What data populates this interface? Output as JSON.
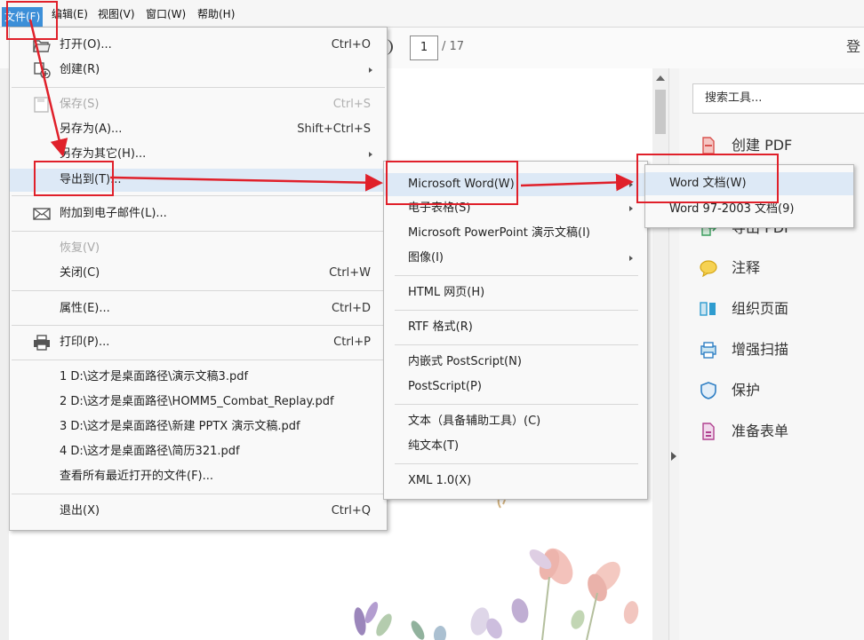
{
  "menubar": {
    "file": "文件(F)",
    "edit": "编辑(E)",
    "view": "视图(V)",
    "window": "窗口(W)",
    "help": "帮助(H)"
  },
  "toolbar": {
    "page_current": "1",
    "page_total": "/ 17",
    "login": "登"
  },
  "right_panel": {
    "search_placeholder": "搜索工具...",
    "tools": [
      {
        "label": "创建 PDF",
        "icon": "create-pdf-icon"
      },
      {
        "label": "导出 PDF",
        "icon": "export-pdf-icon"
      },
      {
        "label": "注释",
        "icon": "comment-icon"
      },
      {
        "label": "组织页面",
        "icon": "organize-pages-icon"
      },
      {
        "label": "增强扫描",
        "icon": "enhance-scan-icon"
      },
      {
        "label": "保护",
        "icon": "shield-icon"
      },
      {
        "label": "准备表单",
        "icon": "form-icon"
      }
    ]
  },
  "file_menu": {
    "open": {
      "label": "打开(O)...",
      "shortcut": "Ctrl+O"
    },
    "create": {
      "label": "创建(R)"
    },
    "save": {
      "label": "保存(S)",
      "shortcut": "Ctrl+S"
    },
    "save_as": {
      "label": "另存为(A)...",
      "shortcut": "Shift+Ctrl+S"
    },
    "save_as_other": {
      "label": "另存为其它(H)..."
    },
    "export_to": {
      "label": "导出到(T)..."
    },
    "attach_email": {
      "label": "附加到电子邮件(L)..."
    },
    "revert": {
      "label": "恢复(V)"
    },
    "close": {
      "label": "关闭(C)",
      "shortcut": "Ctrl+W"
    },
    "properties": {
      "label": "属性(E)...",
      "shortcut": "Ctrl+D"
    },
    "print": {
      "label": "打印(P)...",
      "shortcut": "Ctrl+P"
    },
    "recent": [
      "1 D:\\这才是桌面路径\\演示文稿3.pdf",
      "2 D:\\这才是桌面路径\\HOMM5_Combat_Replay.pdf",
      "3 D:\\这才是桌面路径\\新建 PPTX 演示文稿.pdf",
      "4 D:\\这才是桌面路径\\简历321.pdf"
    ],
    "view_all_recent": "查看所有最近打开的文件(F)...",
    "exit": {
      "label": "退出(X)",
      "shortcut": "Ctrl+Q"
    }
  },
  "export_menu": {
    "items": {
      "word": "Microsoft Word(W)",
      "spreadsheet": "电子表格(S)",
      "powerpoint": "Microsoft PowerPoint 演示文稿(I)",
      "image": "图像(I)",
      "html": "HTML 网页(H)",
      "rtf": "RTF 格式(R)",
      "embedded_postscript": "内嵌式 PostScript(N)",
      "postscript": "PostScript(P)",
      "text_accessible": "文本（具备辅助工具）(C)",
      "plain_text": "纯文本(T)",
      "xml": "XML 1.0(X)"
    }
  },
  "word_menu": {
    "word_doc": "Word 文档(W)",
    "word_97": "Word 97-2003 文档(9)"
  },
  "colors": {
    "menu_highlight": "#dde9f6",
    "menubar_active": "#3c8fd8",
    "annotation_red": "#e0202a"
  }
}
